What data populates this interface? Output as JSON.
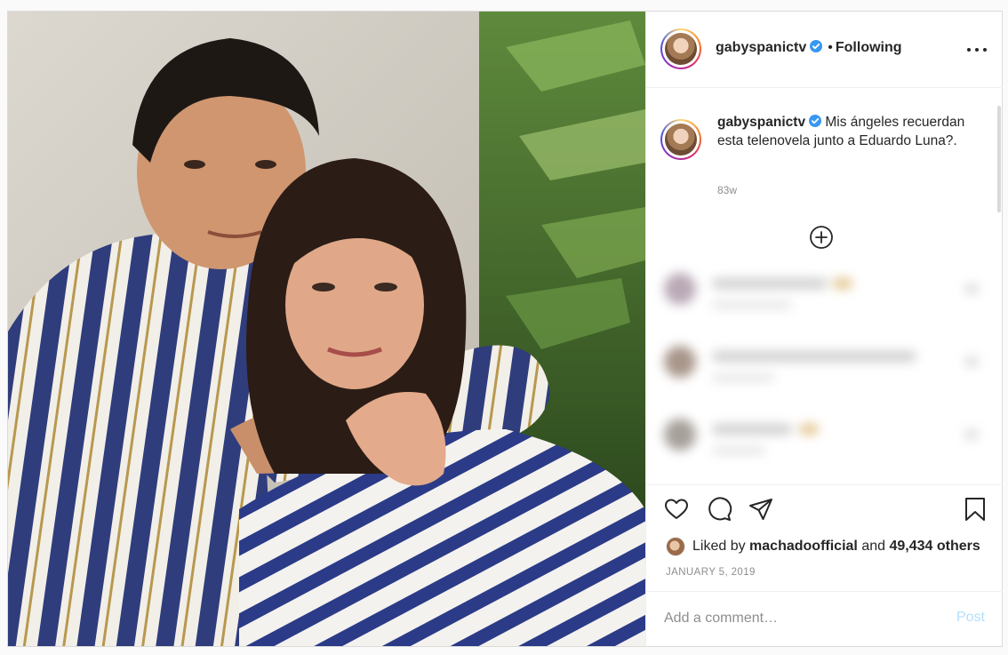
{
  "post": {
    "username": "gabyspanictv",
    "follow_status": "Following",
    "verified": true,
    "caption": "Mis ángeles recuerdan esta telenovela junto a Eduardo Luna?.",
    "time_ago": "83w",
    "liked_by_prefix": "Liked by",
    "liked_by_user": "machadoofficial",
    "liked_by_and": "and",
    "likes_others": "49,434 others",
    "date": "JANUARY 5, 2019"
  },
  "comment_box": {
    "placeholder": "Add a comment…",
    "post_label": "Post"
  },
  "colors": {
    "verified_badge": "#3897f0",
    "post_button_disabled": "#b2dffc",
    "muted_text": "#8e8e8e"
  },
  "icons": {
    "header_menu": "more-horizontal-icon",
    "load_more": "plus-circle-icon",
    "like": "heart-icon",
    "comment": "speech-bubble-icon",
    "share": "paper-plane-icon",
    "save": "bookmark-icon"
  }
}
